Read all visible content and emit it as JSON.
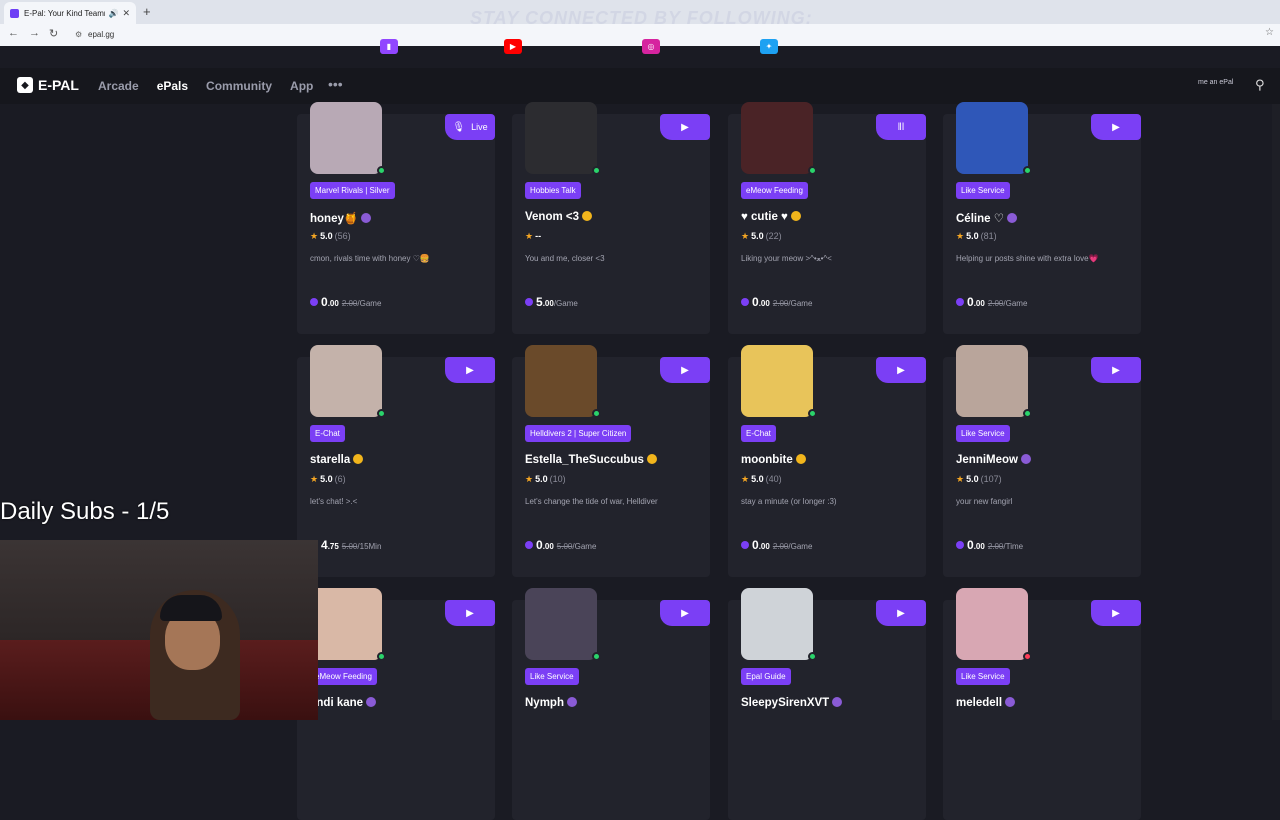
{
  "browser": {
    "tab_title": "E-Pal: Your Kind Teammates",
    "url": "epal.gg"
  },
  "overlay": {
    "banner": "STAY CONNECTED BY FOLLOWING:",
    "socials": [
      {
        "icon": "twitch-icon",
        "color": "#9146ff"
      },
      {
        "icon": "youtube-icon",
        "color": "#ff0000"
      },
      {
        "icon": "instagram-icon",
        "color": "#d6249f"
      },
      {
        "icon": "twitter-icon",
        "color": "#1da1f2"
      }
    ],
    "subs": "Daily Subs - 1/5"
  },
  "site": {
    "logo": "E-PAL",
    "nav": [
      "Arcade",
      "ePals",
      "Community",
      "App"
    ],
    "more": "•••",
    "become": "me an ePal"
  },
  "cards": [
    {
      "tag": "Marvel Rivals | Silver",
      "name": "honey🍯",
      "badge": "purple",
      "rating": "5.0",
      "count": "(56)",
      "bio": "cmon, rivals time with honey ♡🍔",
      "price": "0",
      "cents": ".00",
      "old": "2.00",
      "unit": "/Game",
      "btn": "Live",
      "dot": "green"
    },
    {
      "tag": "Hobbies Talk",
      "name": "Venom <3",
      "badge": "gold",
      "rating": "--",
      "count": "",
      "bio": "You and me, closer <3",
      "price": "5",
      "cents": ".00",
      "old": "",
      "unit": " /Game",
      "btn": "",
      "dot": "green"
    },
    {
      "tag": "eMeow Feeding",
      "name": "♥ cutie ♥",
      "badge": "gold",
      "rating": "5.0",
      "count": "(22)",
      "bio": "Liking your meow >^•ﻌ•^<",
      "price": "0",
      "cents": ".00",
      "old": "2.00",
      "unit": "/Game",
      "btn": "pause",
      "dot": "green"
    },
    {
      "tag": "Like Service",
      "name": "Céline ♡",
      "badge": "purple",
      "rating": "5.0",
      "count": "(81)",
      "bio": "Helping ur posts shine with extra love💗",
      "price": "0",
      "cents": ".00",
      "old": "2.00",
      "unit": "/Game",
      "btn": "",
      "dot": "green"
    },
    {
      "tag": "E-Chat",
      "name": "starella",
      "badge": "gold",
      "rating": "5.0",
      "count": "(6)",
      "bio": "let's chat! >.<",
      "price": "4",
      "cents": ".75",
      "old": "5.00",
      "unit": "/15Min",
      "btn": "",
      "dot": "green"
    },
    {
      "tag": "Helldivers 2 | Super Citizen",
      "name": "Estella_TheSuccubus",
      "badge": "gold",
      "rating": "5.0",
      "count": "(10)",
      "bio": "Let's change the tide of war, Helldiver",
      "price": "0",
      "cents": ".00",
      "old": "5.00",
      "unit": "/Game",
      "btn": "",
      "dot": "green"
    },
    {
      "tag": "E-Chat",
      "name": "moonbite",
      "badge": "gold",
      "rating": "5.0",
      "count": "(40)",
      "bio": "stay a minute (or longer :3)",
      "price": "0",
      "cents": ".00",
      "old": "2.00",
      "unit": "/Game",
      "btn": "",
      "dot": "green"
    },
    {
      "tag": "Like Service",
      "name": "JenniMeow",
      "badge": "purple",
      "rating": "5.0",
      "count": "(107)",
      "bio": "your new fangirl",
      "price": "0",
      "cents": ".00",
      "old": "2.00",
      "unit": "/Time",
      "btn": "",
      "dot": "green"
    },
    {
      "tag": "eMeow Feeding",
      "name": "endi kane",
      "badge": "purple",
      "rating": "",
      "count": "",
      "bio": "",
      "price": "",
      "cents": "",
      "old": "",
      "unit": "",
      "btn": "",
      "dot": "green"
    },
    {
      "tag": "Like Service",
      "name": "Nymph",
      "badge": "purple",
      "rating": "",
      "count": "",
      "bio": "",
      "price": "",
      "cents": "",
      "old": "",
      "unit": "",
      "btn": "",
      "dot": "green"
    },
    {
      "tag": "Epal Guide",
      "name": "SleepySirenXVT",
      "badge": "purple",
      "rating": "",
      "count": "",
      "bio": "",
      "price": "",
      "cents": "",
      "old": "",
      "unit": "",
      "btn": "",
      "dot": "green"
    },
    {
      "tag": "Like Service",
      "name": "meledell",
      "badge": "purple",
      "rating": "",
      "count": "",
      "bio": "",
      "price": "",
      "cents": "",
      "old": "",
      "unit": "",
      "btn": "",
      "dot": "red"
    }
  ],
  "avatar_colors": [
    "#b8a9b5",
    "#2c2c30",
    "#4a2326",
    "#2f57b8",
    "#c4b2aa",
    "#6a4a2a",
    "#e8c45a",
    "#b9a59b",
    "#d9b8a6",
    "#4a4458",
    "#cfd3d8",
    "#d8a7b3"
  ]
}
